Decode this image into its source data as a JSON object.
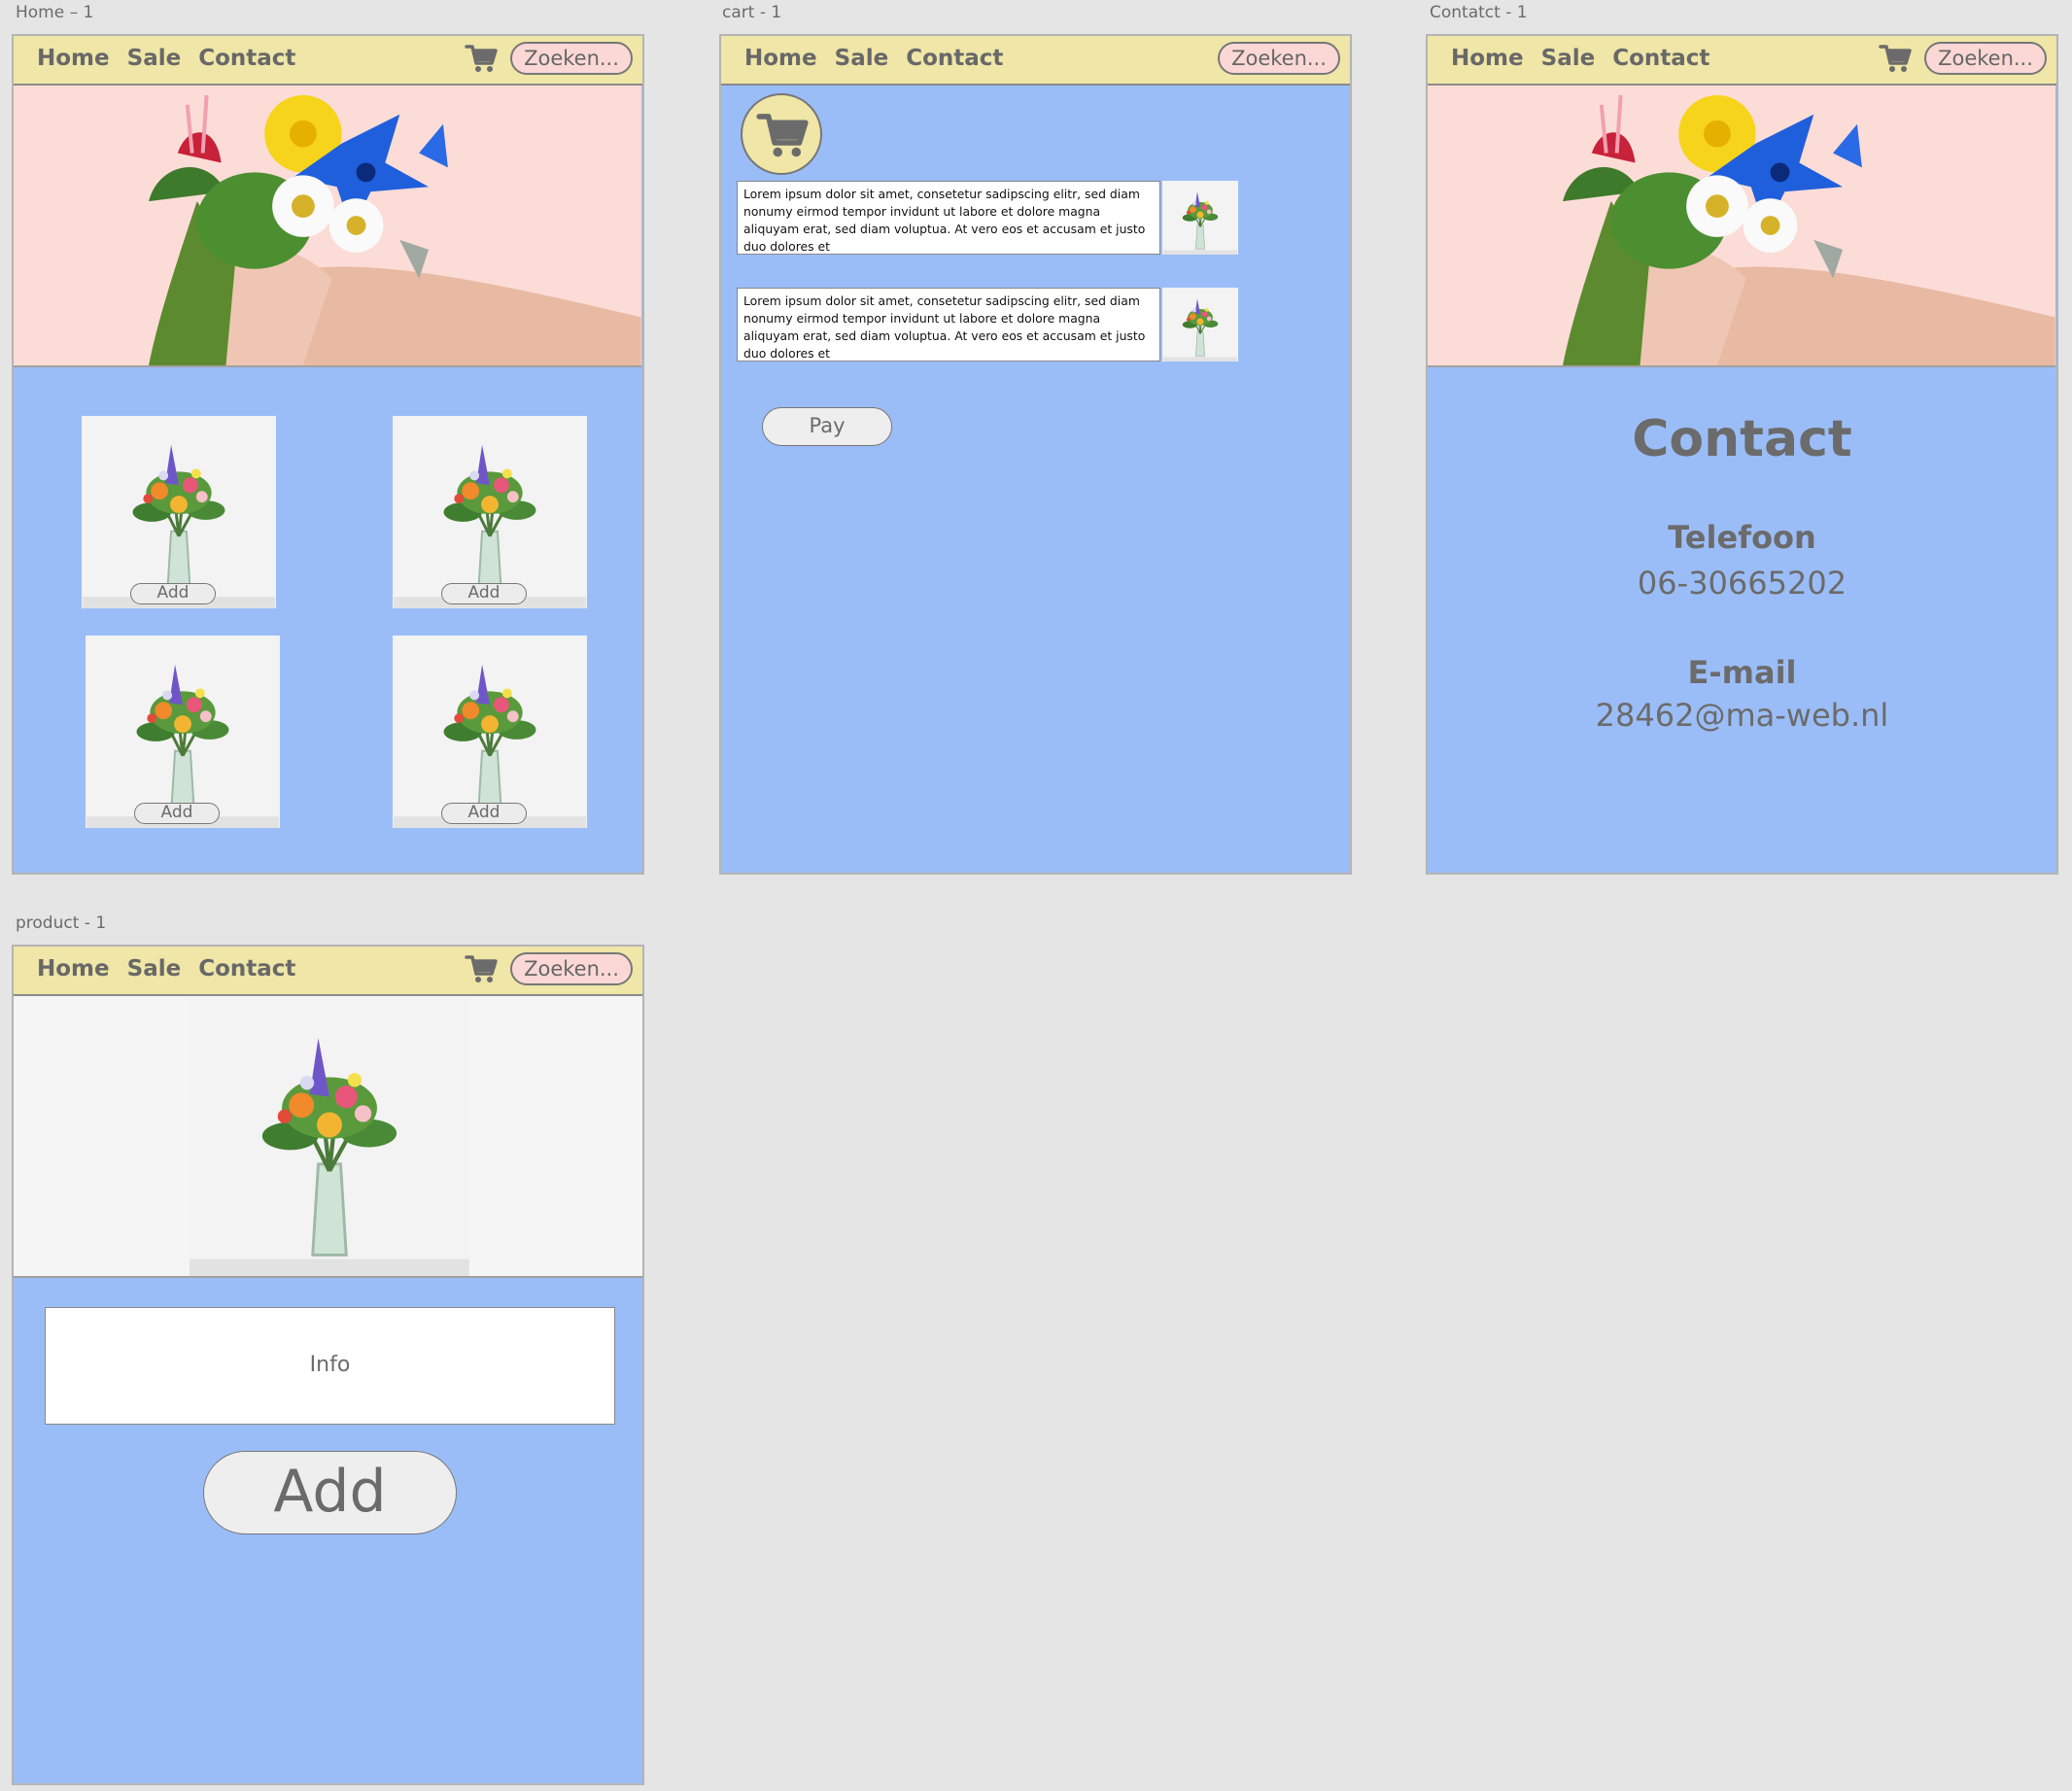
{
  "artboards": {
    "home": "Home – 1",
    "cart": "cart - 1",
    "contact": "Contatct - 1",
    "product": "product - 1"
  },
  "nav": {
    "home": "Home",
    "sale": "Sale",
    "contact": "Contact",
    "search_placeholder": "Zoeken..."
  },
  "home": {
    "add_label": "Add"
  },
  "cart": {
    "items": [
      {
        "text": "Lorem ipsum dolor sit amet, consetetur sadipscing elitr, sed diam nonumy eirmod tempor invidunt ut labore et dolore magna aliquyam erat, sed diam voluptua. At vero eos et accusam et justo duo dolores et"
      },
      {
        "text": "Lorem ipsum dolor sit amet, consetetur sadipscing elitr, sed diam nonumy eirmod tempor invidunt ut labore et dolore magna aliquyam erat, sed diam voluptua. At vero eos et accusam et justo duo dolores et"
      }
    ],
    "pay_label": "Pay"
  },
  "contact": {
    "title": "Contact",
    "phone_label": "Telefoon",
    "phone": "06-30665202",
    "email_label": "E-mail",
    "email": "28462@ma-web.nl"
  },
  "product": {
    "info_label": "Info",
    "add_label": "Add"
  },
  "colors": {
    "navbar": "#efe6a7",
    "content_bg": "#9bbdf7",
    "hero_bg": "#fcdcd7",
    "search_bg": "#fbd8d6",
    "text_gray": "#686868"
  }
}
